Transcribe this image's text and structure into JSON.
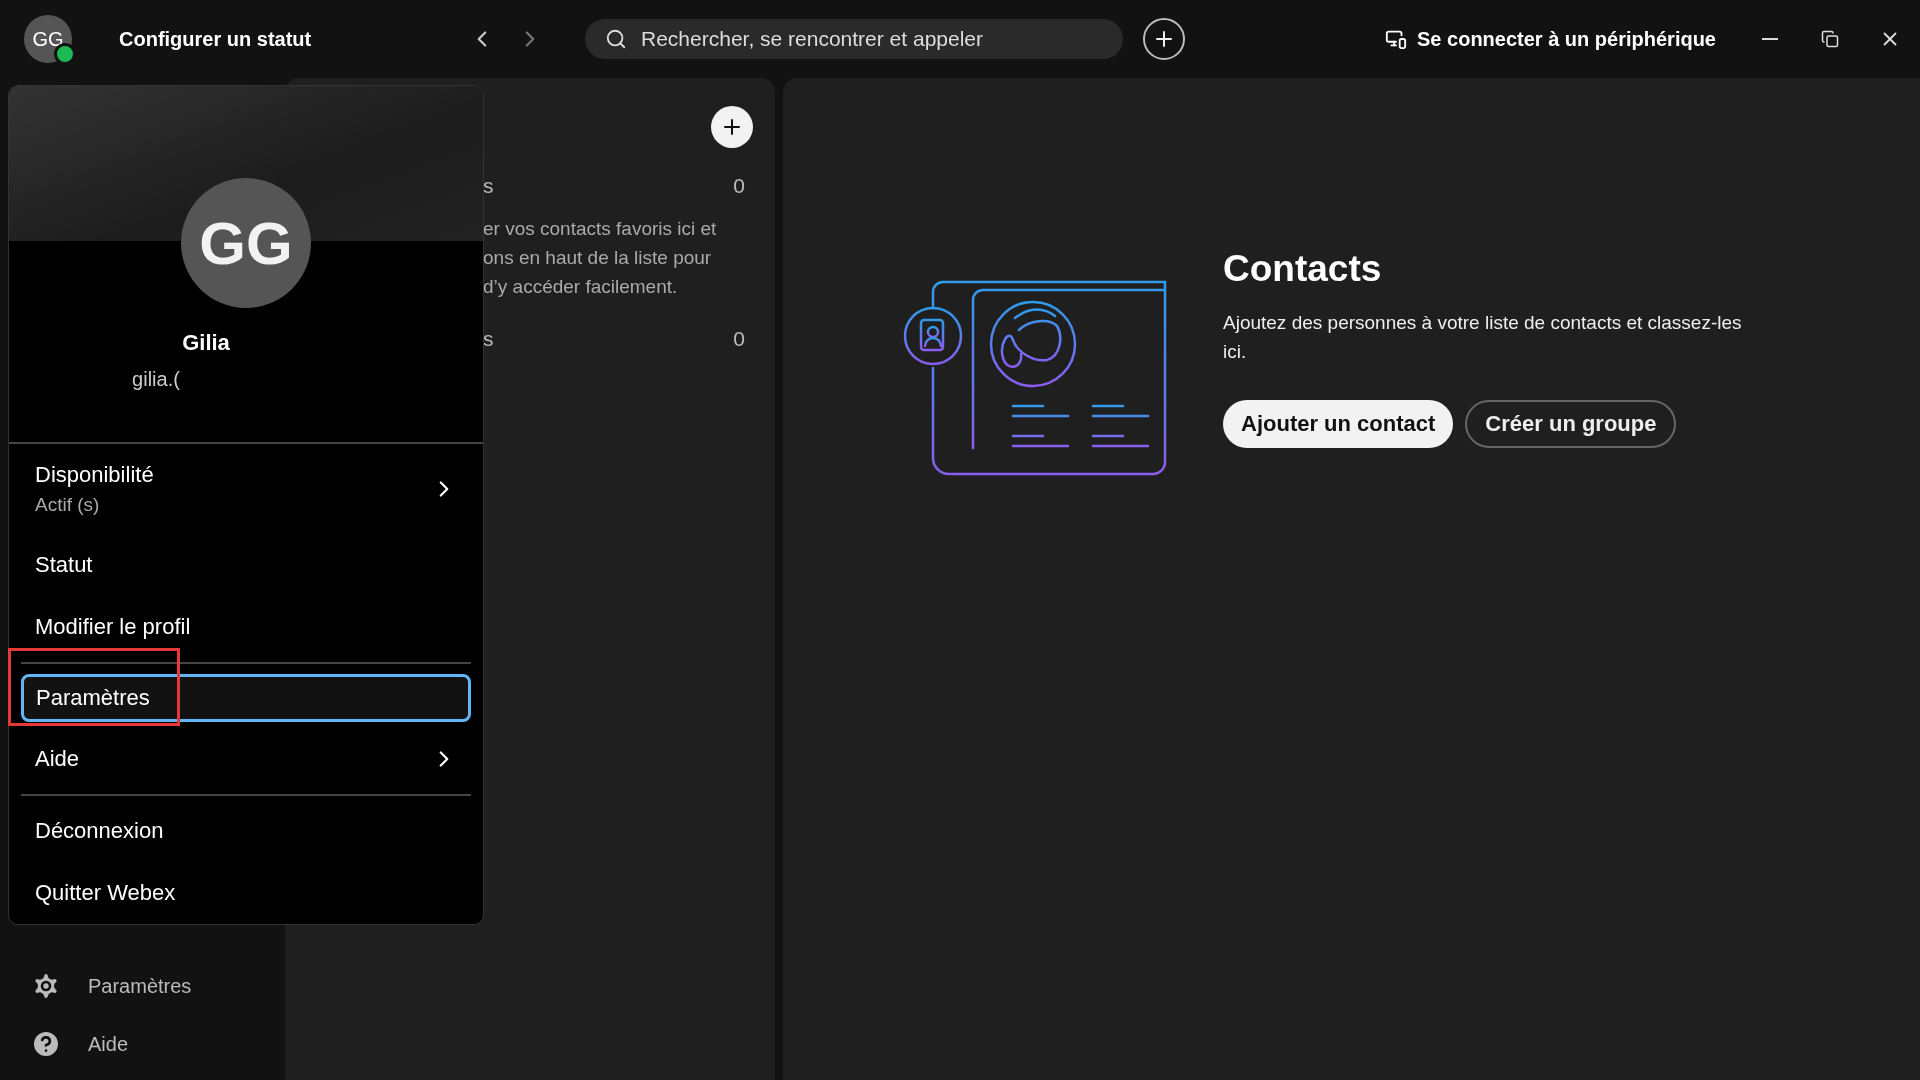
{
  "top_bar": {
    "avatar": {
      "initials": "GG",
      "online": true
    },
    "title": "Configurer un statut",
    "search": {
      "placeholder": "Rechercher, se rencontrer et appeler"
    },
    "device_link": "Se connecter à un périphérique"
  },
  "profile_menu": {
    "initials": "GG",
    "name": "Gilia",
    "email": "gilia.(",
    "items": [
      {
        "kind": "item",
        "label": "Disponibilité",
        "sub": "Actif (s)",
        "submenu": true,
        "selected": false
      },
      {
        "kind": "item",
        "label": "Statut",
        "submenu": false,
        "selected": false
      },
      {
        "kind": "item",
        "label": "Modifier le profil",
        "submenu": false,
        "selected": false
      },
      {
        "kind": "divider"
      },
      {
        "kind": "item",
        "label": "Paramètres",
        "submenu": false,
        "selected": true
      },
      {
        "kind": "item",
        "label": "Aide",
        "submenu": true,
        "selected": false
      },
      {
        "kind": "divider"
      },
      {
        "kind": "item",
        "label": "Déconnexion",
        "submenu": false,
        "selected": false
      },
      {
        "kind": "item",
        "label": "Quitter Webex",
        "submenu": false,
        "selected": false
      }
    ]
  },
  "sidebar": {
    "items": [
      {
        "kind": "settings",
        "label": "Paramètres"
      },
      {
        "kind": "help",
        "label": "Aide"
      }
    ]
  },
  "list_panel": {
    "sections": [
      {
        "title": "s",
        "count": "0",
        "text_lines": [
          "er vos contacts favoris ici et",
          "ons en haut de la liste pour",
          "d’y accéder facilement."
        ]
      },
      {
        "title": "s",
        "count": "0"
      }
    ]
  },
  "contacts": {
    "title": "Contacts",
    "description": "Ajoutez des personnes à votre liste de contacts et classez-les ici.",
    "buttons": [
      {
        "kind": "primary",
        "label": "Ajouter un contact"
      },
      {
        "kind": "secondary",
        "label": "Créer un groupe"
      }
    ]
  }
}
